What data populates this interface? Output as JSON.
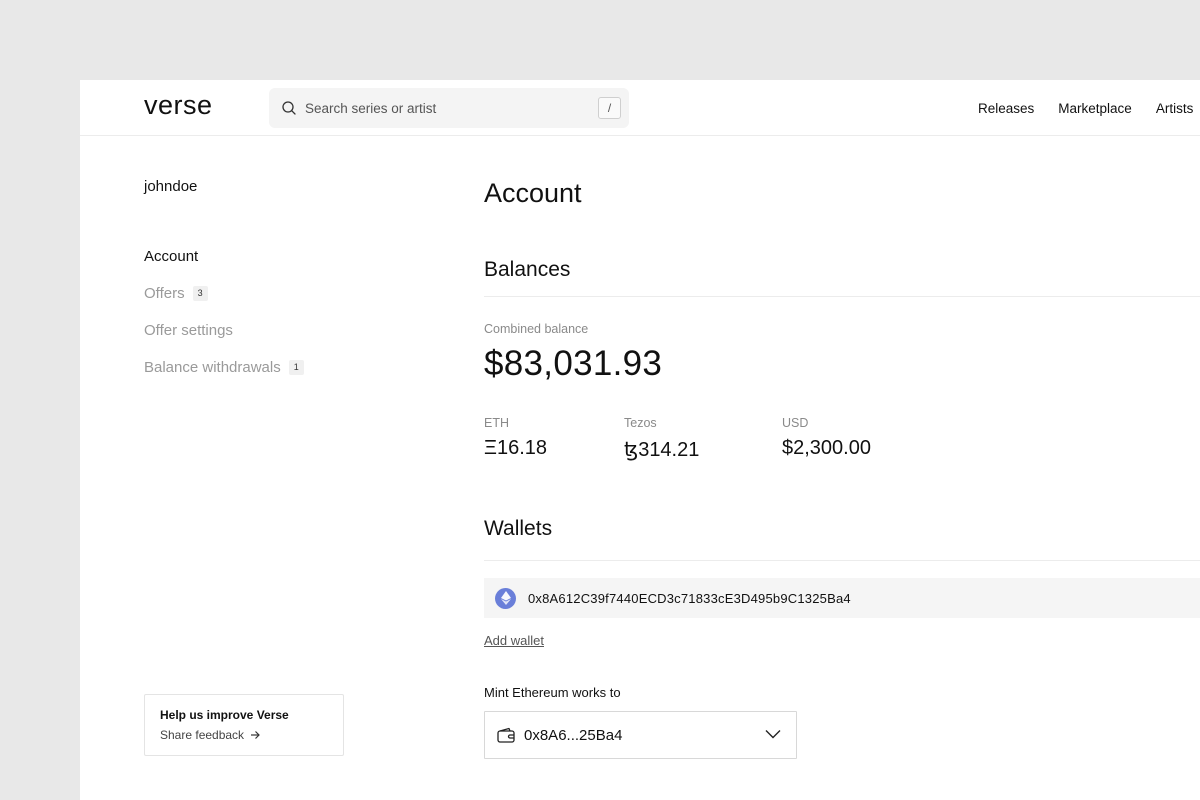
{
  "header": {
    "logo": "verse",
    "search_placeholder": "Search series or artist",
    "search_shortcut": "/",
    "nav": [
      "Releases",
      "Marketplace",
      "Artists"
    ]
  },
  "sidebar": {
    "username": "johndoe",
    "items": [
      {
        "label": "Account",
        "active": true,
        "badge": ""
      },
      {
        "label": "Offers",
        "active": false,
        "badge": "3"
      },
      {
        "label": "Offer settings",
        "active": false,
        "badge": ""
      },
      {
        "label": "Balance withdrawals",
        "active": false,
        "badge": "1"
      }
    ],
    "feedback": {
      "title": "Help us improve Verse",
      "link": "Share feedback"
    }
  },
  "main": {
    "title": "Account",
    "balances": {
      "title": "Balances",
      "combined_label": "Combined balance",
      "combined_value": "$83,031.93",
      "currencies": [
        {
          "label": "ETH",
          "value": "Ξ16.18"
        },
        {
          "label": "Tezos",
          "value": "ꜩ314.21"
        },
        {
          "label": "USD",
          "value": "$2,300.00"
        }
      ]
    },
    "wallets": {
      "title": "Wallets",
      "address": "0x8A612C39f7440ECD3c71833cE3D495b9C1325Ba4",
      "add_label": "Add wallet",
      "mint_label": "Mint Ethereum works to",
      "selected": "0x8A6...25Ba4"
    }
  },
  "colors": {
    "page_bg": "#e8e8e8",
    "eth_badge": "#6a7fd9",
    "muted_text": "#9a9a9a"
  }
}
